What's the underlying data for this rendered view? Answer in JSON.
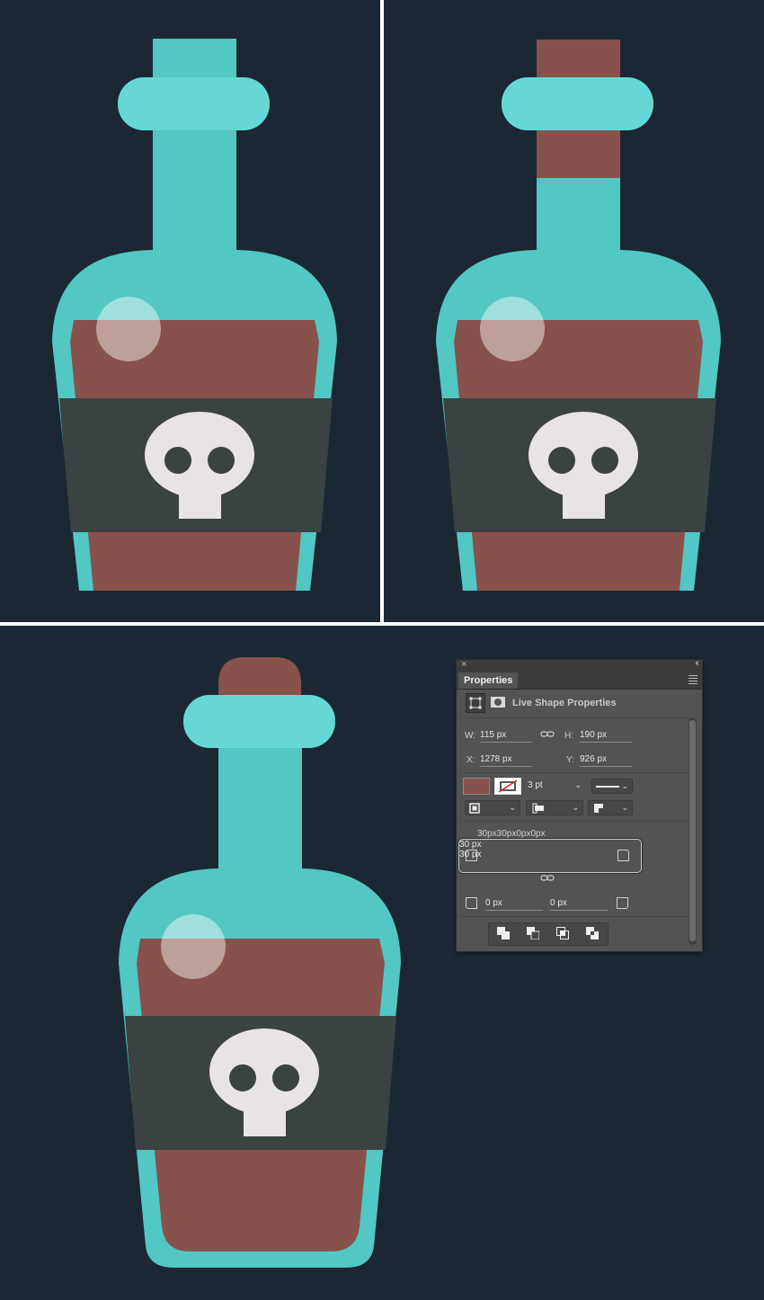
{
  "colors": {
    "background": "#1b2833",
    "glass": "#52c7c4",
    "glass_light": "#65d8d5",
    "liquid": "#87524b",
    "label": "#3b4242",
    "skull": "#e8e4e3",
    "divider": "#ffffff"
  },
  "properties_panel": {
    "tab_title": "Properties",
    "subtitle": "Live Shape Properties",
    "w_label": "W:",
    "w_value": "115 px",
    "h_label": "H:",
    "h_value": "190 px",
    "x_label": "X:",
    "x_value": "1278 px",
    "y_label": "Y:",
    "y_value": "926 px",
    "stroke_width": "3 pt",
    "corner_summary": "30px30px0px0px",
    "corner_top_left": "30 px",
    "corner_top_right": "30 px",
    "corner_bottom_left": "0 px",
    "corner_bottom_right": "0 px",
    "fill_color": "#87524b",
    "icons": [
      "transform-icon",
      "mask-icon",
      "link-icon",
      "close-icon",
      "collapse-icon",
      "panel-menu-icon"
    ]
  }
}
